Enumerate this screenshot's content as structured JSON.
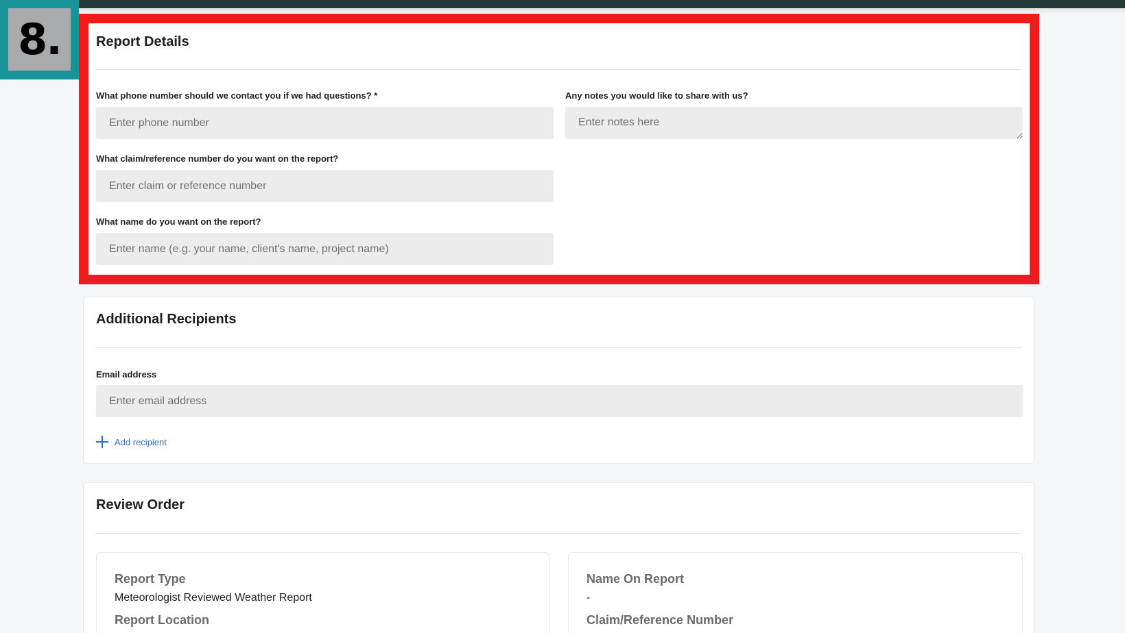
{
  "step_badge": {
    "label": "8."
  },
  "report_details": {
    "title": "Report Details",
    "phone": {
      "label": "What phone number should we contact you if we had questions? *",
      "placeholder": "Enter phone number"
    },
    "notes": {
      "label": "Any notes you would like to share with us?",
      "placeholder": "Enter notes here"
    },
    "claim": {
      "label": "What claim/reference number do you want on the report?",
      "placeholder": "Enter claim or reference number"
    },
    "name": {
      "label": "What name do you want on the report?",
      "placeholder": "Enter name (e.g. your name, client's name, project name)"
    }
  },
  "additional_recipients": {
    "title": "Additional Recipients",
    "email": {
      "label": "Email address",
      "placeholder": "Enter email address"
    },
    "add_label": "Add recipient"
  },
  "review_order": {
    "title": "Review Order",
    "left": {
      "report_type_label": "Report Type",
      "report_type_value": "Meteorologist Reviewed Weather Report",
      "report_location_label": "Report Location"
    },
    "right": {
      "name_label": "Name On Report",
      "name_value": "-",
      "claim_label": "Claim/Reference Number"
    }
  },
  "colors": {
    "highlight": "#f21b1b",
    "badge": "#17949a",
    "link": "#2a6fd6",
    "topbar": "#243936"
  }
}
